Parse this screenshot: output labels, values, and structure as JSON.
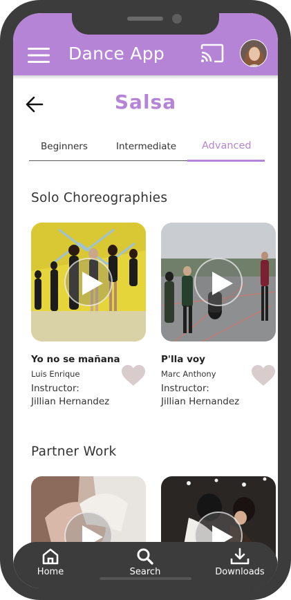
{
  "app": {
    "title": "Dance App"
  },
  "page": {
    "title": "Salsa"
  },
  "tabs": [
    {
      "label": "Beginners",
      "active": false
    },
    {
      "label": "Intermediate",
      "active": false
    },
    {
      "label": "Advanced",
      "active": true
    }
  ],
  "sections": [
    {
      "title": "Solo Choreographies",
      "cards": [
        {
          "song": "Yo no se mañana",
          "artist": "Luis Enrique",
          "instructor_label": "Instructor:",
          "instructor": "Jillian Hernandez"
        },
        {
          "song": "P'lla voy",
          "artist": "Marc Anthony",
          "instructor_label": "Instructor:",
          "instructor": "Jillian Hernandez"
        }
      ]
    },
    {
      "title": "Partner Work",
      "cards": [
        {
          "song": "",
          "artist": "",
          "instructor_label": "",
          "instructor": ""
        },
        {
          "song": "",
          "artist": "",
          "instructor_label": "",
          "instructor": ""
        }
      ]
    }
  ],
  "bottom_nav": [
    {
      "label": "Home",
      "icon": "home-icon"
    },
    {
      "label": "Search",
      "icon": "search-icon"
    },
    {
      "label": "Downloads",
      "icon": "download-icon"
    }
  ],
  "colors": {
    "accent": "#b684d6",
    "frame": "#3c3c3c",
    "heart": "#d9cccc"
  }
}
